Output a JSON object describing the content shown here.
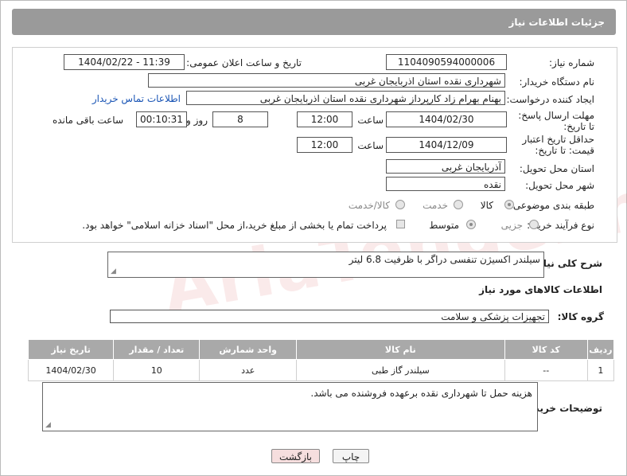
{
  "header": {
    "title": "جزئیات اطلاعات نیاز"
  },
  "form": {
    "need_number": {
      "label": "شماره نیاز:",
      "value": "1104090594000006"
    },
    "announce": {
      "label": "تاریخ و ساعت اعلان عمومی:",
      "value": "1404/02/22 - 11:39"
    },
    "buyer_org": {
      "label": "نام دستگاه خریدار:",
      "value": "شهرداری نقده استان اذربایجان غربی"
    },
    "requester": {
      "label": "ایجاد کننده درخواست:",
      "value": "بهنام بهرام زاد کارپرداز شهرداری نقده استان اذربایجان غربی",
      "contact_link": "اطلاعات تماس خریدار"
    },
    "reply_deadline": {
      "label": "مهلت ارسال پاسخ: تا تاریخ:",
      "date": "1404/02/30",
      "time_label": "ساعت",
      "time": "12:00",
      "days": "8",
      "days_label": "روز و",
      "remaining": "00:10:31",
      "remaining_label": "ساعت باقی مانده"
    },
    "price_validity": {
      "label": "حداقل تاریخ اعتبار قیمت: تا تاریخ:",
      "date": "1404/12/09",
      "time_label": "ساعت",
      "time": "12:00"
    },
    "delivery_province": {
      "label": "استان محل تحویل:",
      "value": "آذربایجان غربی"
    },
    "delivery_city": {
      "label": "شهر محل تحویل:",
      "value": "نقده"
    },
    "category": {
      "label": "طبقه بندی موضوعی:",
      "options": [
        "کالا",
        "خدمت",
        "کالا/خدمت"
      ],
      "selected": "کالا"
    },
    "process_type": {
      "label": "نوع فرآیند خرید :",
      "options": [
        "جزیی",
        "متوسط"
      ],
      "selected": "متوسط",
      "payment_note": "پرداخت تمام یا بخشی از مبلغ خرید،از محل \"اسناد خزانه اسلامی\" خواهد بود."
    }
  },
  "description": {
    "label": "شرح کلی نیاز:",
    "value": "سیلندر اکسیژن تنفسی دراگر با ظرفیت 6.8 لیتر"
  },
  "goods_section": {
    "title": "اطلاعات کالاهای مورد نیاز",
    "group_label": "گروه کالا:",
    "group_value": "تجهیزات پزشکی و سلامت"
  },
  "items_table": {
    "headers": [
      "ردیف",
      "کد کالا",
      "نام کالا",
      "واحد شمارش",
      "تعداد / مقدار",
      "تاریخ نیاز"
    ],
    "rows": [
      [
        "1",
        "--",
        "سیلندر گاز طبی",
        "عدد",
        "10",
        "1404/02/30"
      ]
    ]
  },
  "buyer_notes": {
    "label": "توضیحات خریدار:",
    "value": "هزینه حمل تا شهرداری نقده برعهده فروشنده می باشد."
  },
  "buttons": {
    "print": "چاپ",
    "back": "بازگشت"
  },
  "watermark": "AriaTender.neT",
  "colors": {
    "header_bg": "#9a9a9a",
    "link": "#1a55b5",
    "back_button_bg": "#f6dede"
  }
}
